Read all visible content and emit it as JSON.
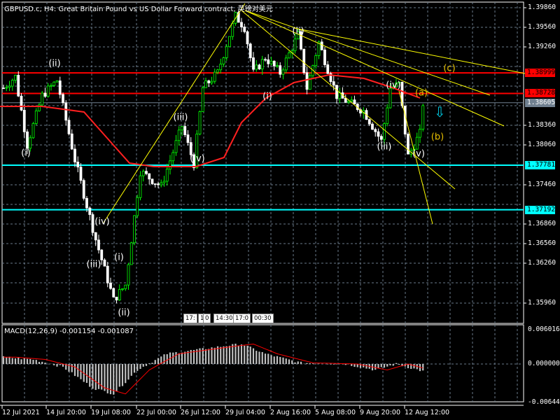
{
  "header": {
    "title": "GBPUSD.c, H4:  Great Britain Pound vs US Dollar Forward contract, 英镑对美元"
  },
  "macd": {
    "title": "MACD(12,26,9) -0.001154 -0.001087",
    "axis": [
      "0.006016",
      "0.000000",
      "-0.006440"
    ]
  },
  "price_axis": [
    "1.39860",
    "1.39560",
    "1.39260",
    "1.38360",
    "1.38060",
    "1.37460",
    "1.36860",
    "1.36560",
    "1.36260",
    "1.35960"
  ],
  "levels": [
    {
      "label": "1.38999",
      "price": 1.38999,
      "color": "#ff0000",
      "text_color": "#000000"
    },
    {
      "label": "1.38728",
      "price": 1.38728,
      "color": "#ff0000",
      "text_color": "#000000"
    },
    {
      "label": "1.38605",
      "price": 1.38605,
      "color": "#708090",
      "text_color": "#ffffff"
    },
    {
      "label": "1.37781",
      "price": 1.37781,
      "color": "#00ffff",
      "text_color": "#000000"
    },
    {
      "label": "1.37192",
      "price": 1.37192,
      "color": "#00ffff",
      "text_color": "#000000"
    }
  ],
  "time_axis": [
    "12 Jul 2021",
    "14 Jul 20:00",
    "19 Jul 08:00",
    "22 Jul 00:00",
    "26 Jul 12:00",
    "29 Jul 04:00",
    "2 Aug 16:00",
    "5 Aug 08:00",
    "9 Aug 20:00",
    "12 Aug 12:00"
  ],
  "time_boxes": [
    "17:",
    "17",
    "0",
    "14:30",
    "17:0",
    "00:30"
  ],
  "waves": [
    {
      "label": "(ii)",
      "color": "#ffffff"
    },
    {
      "label": "(i)",
      "color": "#ffffff"
    },
    {
      "label": "(iv)",
      "color": "#ffffff"
    },
    {
      "label": "(iii)",
      "color": "#ffffff"
    },
    {
      "label": "(i)",
      "color": "#ffffff"
    },
    {
      "label": "(ii)",
      "color": "#ffffff"
    },
    {
      "label": "(iii)",
      "color": "#ffffff"
    },
    {
      "label": "(iv)",
      "color": "#ffffff"
    },
    {
      "label": "(i)",
      "color": "#ffffff"
    },
    {
      "label": "(ii)",
      "color": "#ffffff"
    },
    {
      "label": "(iii)",
      "color": "#ffffff"
    },
    {
      "label": "(iv)",
      "color": "#ffffff"
    },
    {
      "label": "(v)",
      "color": "#ffffff"
    },
    {
      "label": "(a)",
      "color": "#e8c000"
    },
    {
      "label": "(b)",
      "color": "#e8c000"
    },
    {
      "label": "(c)",
      "color": "#e8c000"
    }
  ],
  "arrow": {
    "icon": "down-arrow-icon",
    "glyph": "⇩"
  },
  "chart_data": {
    "type": "candlestick",
    "symbol": "GBPUSD.c",
    "timeframe": "H4",
    "ylim": [
      1.3565,
      1.3995
    ],
    "close_path": [
      [
        0,
        1.388
      ],
      [
        4,
        1.3895
      ],
      [
        8,
        1.3805
      ],
      [
        13,
        1.387
      ],
      [
        18,
        1.389
      ],
      [
        24,
        1.3785
      ],
      [
        31,
        1.368
      ],
      [
        37,
        1.36
      ],
      [
        41,
        1.362
      ],
      [
        46,
        1.377
      ],
      [
        53,
        1.375
      ],
      [
        60,
        1.383
      ],
      [
        64,
        1.378
      ],
      [
        67,
        1.388
      ],
      [
        72,
        1.39
      ],
      [
        78,
        1.3975
      ],
      [
        81,
        1.396
      ],
      [
        84,
        1.39
      ],
      [
        88,
        1.392
      ],
      [
        93,
        1.39
      ],
      [
        99,
        1.395
      ],
      [
        102,
        1.388
      ],
      [
        106,
        1.394
      ],
      [
        112,
        1.387
      ],
      [
        121,
        1.385
      ],
      [
        127,
        1.381
      ],
      [
        130,
        1.388
      ],
      [
        133,
        1.3885
      ],
      [
        136,
        1.379
      ],
      [
        140,
        1.382
      ],
      [
        141,
        1.386
      ]
    ],
    "macd_hist_path": [
      [
        0,
        0.0012
      ],
      [
        10,
        0.0008
      ],
      [
        20,
        -0.0005
      ],
      [
        30,
        -0.004
      ],
      [
        37,
        -0.005
      ],
      [
        45,
        -0.001
      ],
      [
        55,
        0.0018
      ],
      [
        65,
        0.0025
      ],
      [
        75,
        0.0032
      ],
      [
        80,
        0.0035
      ],
      [
        88,
        0.0018
      ],
      [
        100,
        0.0002
      ],
      [
        115,
        0.0
      ],
      [
        125,
        -0.001
      ],
      [
        132,
        0.0
      ],
      [
        141,
        -0.0012
      ]
    ]
  }
}
